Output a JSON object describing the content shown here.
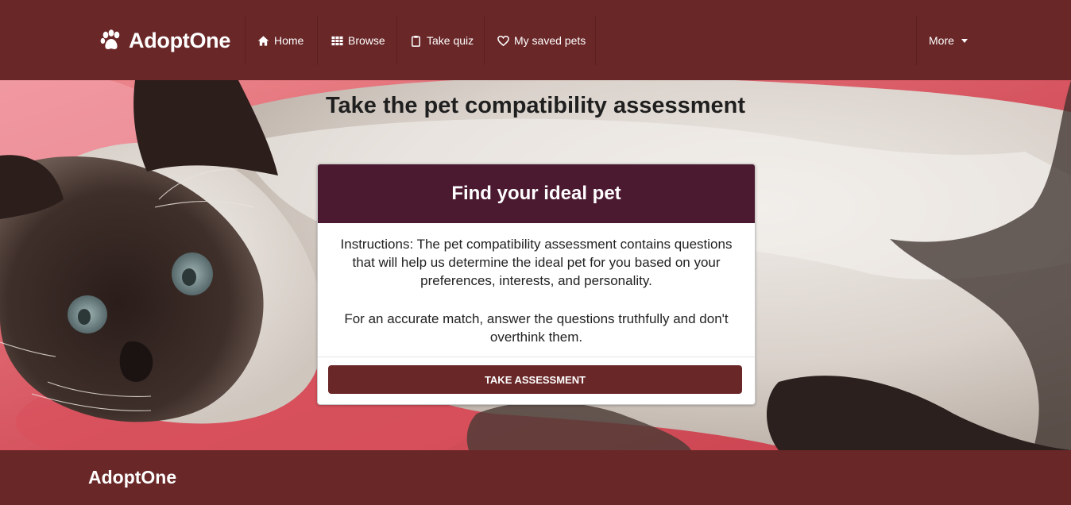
{
  "navbar": {
    "brand": "AdoptOne",
    "items": [
      {
        "label": "Home",
        "icon": "home-icon"
      },
      {
        "label": "Browse",
        "icon": "grid-icon"
      },
      {
        "label": "Take quiz",
        "icon": "clipboard-icon"
      },
      {
        "label": "My saved pets",
        "icon": "heart-icon"
      }
    ],
    "more_label": "More"
  },
  "hero": {
    "title": "Take the pet compatibility assessment",
    "image": "siamese-cat-photo"
  },
  "card": {
    "title": "Find your ideal pet",
    "paragraphs": [
      "Instructions: The pet compatibility assessment contains questions that will help us determine the ideal pet for you based on your preferences, interests, and personality.",
      "For an accurate match, answer the questions truthfully and don't overthink them."
    ],
    "button_label": "TAKE ASSESSMENT"
  },
  "footer": {
    "brand": "AdoptOne"
  },
  "colors": {
    "brand": "#6a2728",
    "card_header": "#4b1930",
    "title_text": "#1f1f1f"
  }
}
